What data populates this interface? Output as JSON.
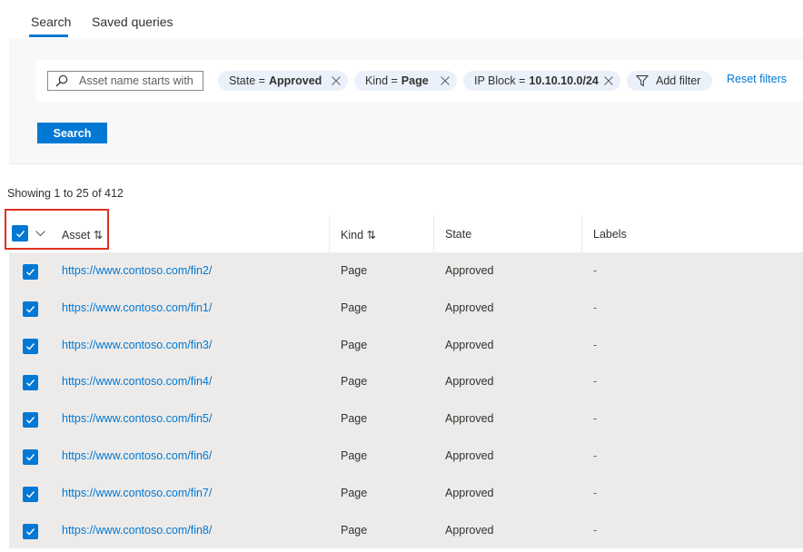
{
  "tabs": [
    {
      "label": "Search",
      "active": true
    },
    {
      "label": "Saved queries",
      "active": false
    }
  ],
  "search": {
    "placeholder": "Asset name starts with"
  },
  "filters": [
    {
      "key": "State =",
      "value": "Approved"
    },
    {
      "key": "Kind =",
      "value": "Page"
    },
    {
      "key": "IP Block =",
      "value": "10.10.10.0/24"
    }
  ],
  "add_filter_label": "Add filter",
  "reset_filters_label": "Reset filters",
  "search_button_label": "Search",
  "showing_text": "Showing 1 to 25 of 412",
  "table": {
    "columns": {
      "asset": "Asset ⇅",
      "kind": "Kind ⇅",
      "state": "State",
      "labels": "Labels"
    },
    "rows": [
      {
        "asset": "https://www.contoso.com/fin2/",
        "kind": "Page",
        "state": "Approved",
        "labels": "-"
      },
      {
        "asset": "https://www.contoso.com/fin1/",
        "kind": "Page",
        "state": "Approved",
        "labels": "-"
      },
      {
        "asset": "https://www.contoso.com/fin3/",
        "kind": "Page",
        "state": "Approved",
        "labels": "-"
      },
      {
        "asset": "https://www.contoso.com/fin4/",
        "kind": "Page",
        "state": "Approved",
        "labels": "-"
      },
      {
        "asset": "https://www.contoso.com/fin5/",
        "kind": "Page",
        "state": "Approved",
        "labels": "-"
      },
      {
        "asset": "https://www.contoso.com/fin6/",
        "kind": "Page",
        "state": "Approved",
        "labels": "-"
      },
      {
        "asset": "https://www.contoso.com/fin7/",
        "kind": "Page",
        "state": "Approved",
        "labels": "-"
      },
      {
        "asset": "https://www.contoso.com/fin8/",
        "kind": "Page",
        "state": "Approved",
        "labels": "-"
      }
    ]
  },
  "colors": {
    "accent": "#0078d4",
    "highlight": "#e0301e",
    "row_bg": "#edebe9",
    "pill_bg": "#eaf1fb"
  },
  "icons": [
    "search-icon",
    "close-icon",
    "filter-icon",
    "checkmark-icon",
    "chevron-down-icon"
  ]
}
